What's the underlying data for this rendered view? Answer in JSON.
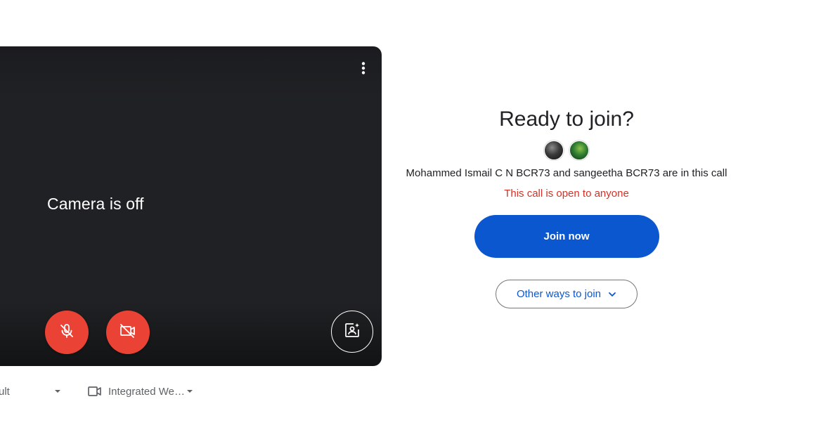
{
  "preview": {
    "status_text": "Camera is off",
    "icons": {
      "more": "more-vert-icon",
      "mic": "mic-off-icon",
      "camera": "videocam-off-icon",
      "effects": "visual-effects-icon"
    },
    "mic_button_color": "#ea4335",
    "camera_button_color": "#ea4335"
  },
  "devices": {
    "audio_label": "ult",
    "video_label": "Integrated We…",
    "video_icon": "videocam-icon"
  },
  "join_panel": {
    "title": "Ready to join?",
    "participants_text": "Mohammed Ismail C N BCR73 and sangeetha BCR73 are in this call",
    "open_notice": "This call is open to anyone",
    "join_button_label": "Join now",
    "other_ways_label": "Other ways to join",
    "accent_color": "#0b57d0",
    "warning_color": "#d93025"
  }
}
